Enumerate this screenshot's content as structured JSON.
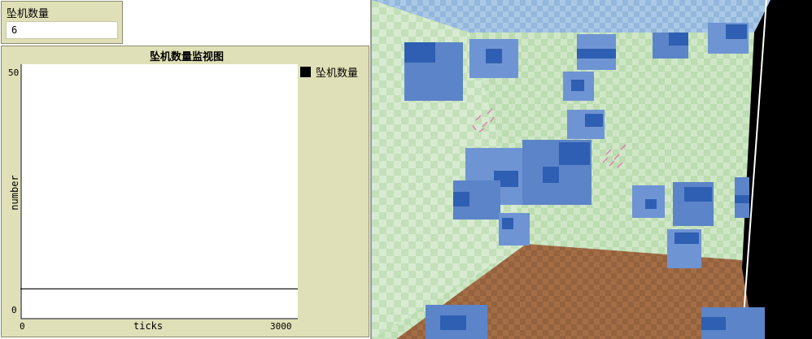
{
  "monitor": {
    "label": "坠机数量",
    "value": "6"
  },
  "plot": {
    "title": "坠机数量监视图",
    "ylabel": "number",
    "xlabel": "ticks",
    "ymin_label": "0",
    "ymax_label": "50",
    "xmin_label": "0",
    "xmax_label": "3000",
    "legend": [
      {
        "name": "坠机数量",
        "color": "#000000"
      }
    ]
  },
  "chart_data": {
    "type": "line",
    "title": "坠机数量监视图",
    "xlabel": "ticks",
    "ylabel": "number",
    "xlim": [
      0,
      3000
    ],
    "ylim": [
      0,
      50
    ],
    "grid": false,
    "legend_placement": "right",
    "series": [
      {
        "name": "坠机数量",
        "color": "#000000",
        "x": [
          0,
          3000
        ],
        "y": [
          6,
          6
        ]
      }
    ]
  },
  "view3d": {
    "colors": {
      "ceiling": "#a9c9e6",
      "wall_green": "#cfe7c7",
      "floor_brown": "#a06a44",
      "cube_blue": "#5c84c9",
      "cube_dark": "#2f5fb2",
      "right_wall": "#000000"
    }
  }
}
